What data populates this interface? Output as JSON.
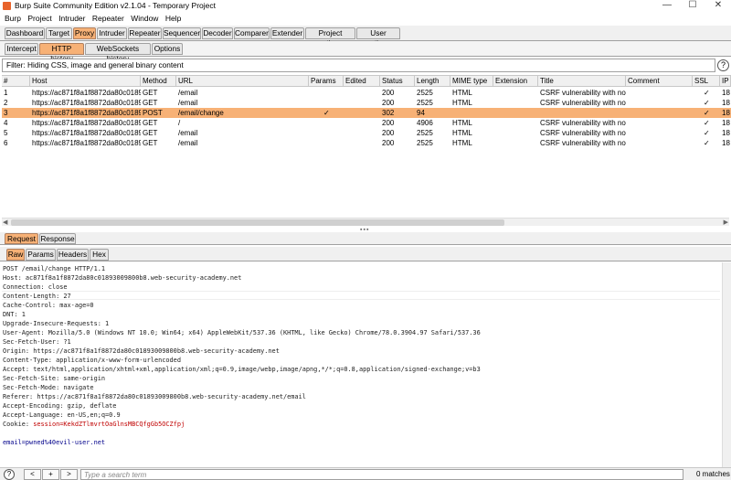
{
  "window": {
    "title": "Burp Suite Community Edition v2.1.04 - Temporary Project",
    "minimize": "—",
    "maximize": "☐",
    "close": "✕"
  },
  "menu": [
    "Burp",
    "Project",
    "Intruder",
    "Repeater",
    "Window",
    "Help"
  ],
  "top_tabs": [
    {
      "label": "Dashboard",
      "active": false
    },
    {
      "label": "Target",
      "active": false
    },
    {
      "label": "Proxy",
      "active": true
    },
    {
      "label": "Intruder",
      "active": false
    },
    {
      "label": "Repeater",
      "active": false
    },
    {
      "label": "Sequencer",
      "active": false
    },
    {
      "label": "Decoder",
      "active": false
    },
    {
      "label": "Comparer",
      "active": false
    },
    {
      "label": "Extender",
      "active": false
    },
    {
      "label": "Project options",
      "active": false
    },
    {
      "label": "User options",
      "active": false
    }
  ],
  "proxy_tabs": [
    {
      "label": "Intercept",
      "active": false
    },
    {
      "label": "HTTP history",
      "active": true
    },
    {
      "label": "WebSockets history",
      "active": false
    },
    {
      "label": "Options",
      "active": false
    }
  ],
  "filter": {
    "text": "Filter: Hiding CSS, image and general binary content",
    "help": "?"
  },
  "table": {
    "columns": [
      "#",
      "Host",
      "Method",
      "URL",
      "Params",
      "Edited",
      "Status",
      "Length",
      "MIME type",
      "Extension",
      "Title",
      "Comment",
      "SSL",
      "IP"
    ],
    "rows": [
      {
        "num": "1",
        "host": "https://ac871f8a1f8872da80c01893...",
        "method": "GET",
        "url": "/email",
        "params": "",
        "edited": "",
        "status": "200",
        "length": "2525",
        "mime": "HTML",
        "ext": "",
        "title": "CSRF vulnerability with no ...",
        "comment": "",
        "ssl": "✓",
        "ip": "18",
        "selected": false
      },
      {
        "num": "2",
        "host": "https://ac871f8a1f8872da80c01893...",
        "method": "GET",
        "url": "/email",
        "params": "",
        "edited": "",
        "status": "200",
        "length": "2525",
        "mime": "HTML",
        "ext": "",
        "title": "CSRF vulnerability with no ...",
        "comment": "",
        "ssl": "✓",
        "ip": "18",
        "selected": false
      },
      {
        "num": "3",
        "host": "https://ac871f8a1f8872da80c01893...",
        "method": "POST",
        "url": "/email/change",
        "params": "✓",
        "edited": "",
        "status": "302",
        "length": "94",
        "mime": "",
        "ext": "",
        "title": "",
        "comment": "",
        "ssl": "✓",
        "ip": "18",
        "selected": true
      },
      {
        "num": "4",
        "host": "https://ac871f8a1f8872da80c01893...",
        "method": "GET",
        "url": "/",
        "params": "",
        "edited": "",
        "status": "200",
        "length": "4906",
        "mime": "HTML",
        "ext": "",
        "title": "CSRF vulnerability with no ...",
        "comment": "",
        "ssl": "✓",
        "ip": "18",
        "selected": false
      },
      {
        "num": "5",
        "host": "https://ac871f8a1f8872da80c01893...",
        "method": "GET",
        "url": "/email",
        "params": "",
        "edited": "",
        "status": "200",
        "length": "2525",
        "mime": "HTML",
        "ext": "",
        "title": "CSRF vulnerability with no ...",
        "comment": "",
        "ssl": "✓",
        "ip": "18",
        "selected": false
      },
      {
        "num": "6",
        "host": "https://ac871f8a1f8872da80c01893...",
        "method": "GET",
        "url": "/email",
        "params": "",
        "edited": "",
        "status": "200",
        "length": "2525",
        "mime": "HTML",
        "ext": "",
        "title": "CSRF vulnerability with no ...",
        "comment": "",
        "ssl": "✓",
        "ip": "18",
        "selected": false
      }
    ]
  },
  "reqresp_tabs": [
    {
      "label": "Request",
      "active": true
    },
    {
      "label": "Response",
      "active": false
    }
  ],
  "view_tabs": [
    {
      "label": "Raw",
      "active": true
    },
    {
      "label": "Params",
      "active": false
    },
    {
      "label": "Headers",
      "active": false
    },
    {
      "label": "Hex",
      "active": false
    }
  ],
  "request_lines": [
    "POST /email/change HTTP/1.1",
    "Host: ac871f8a1f8872da80c01893009800b8.web-security-academy.net",
    "Connection: close",
    "Content-Length: 27",
    "Cache-Control: max-age=0",
    "DNT: 1",
    "Upgrade-Insecure-Requests: 1",
    "User-Agent: Mozilla/5.0 (Windows NT 10.0; Win64; x64) AppleWebKit/537.36 (KHTML, like Gecko) Chrome/78.0.3904.97 Safari/537.36",
    "Sec-Fetch-User: ?1",
    "Origin: https://ac871f8a1f8872da80c01893009800b8.web-security-academy.net",
    "Content-Type: application/x-www-form-urlencoded",
    "Accept: text/html,application/xhtml+xml,application/xml;q=0.9,image/webp,image/apng,*/*;q=0.8,application/signed-exchange;v=b3",
    "Sec-Fetch-Site: same-origin",
    "Sec-Fetch-Mode: navigate",
    "Referer: https://ac871f8a1f8872da80c01893009800b8.web-security-academy.net/email",
    "Accept-Encoding: gzip, deflate",
    "Accept-Language: en-US,en;q=0.9"
  ],
  "cookie": {
    "prefix": "Cookie: ",
    "value": "session=KekdZTlmvrtOaGlnsMBCQfgGb5OCZfpj"
  },
  "body_line": "email=pwned%40evil-user.net",
  "bottom": {
    "help": "?",
    "prev": "<",
    "add": "+",
    "next": ">",
    "search_placeholder": "Type a search term",
    "matches": "0 matches"
  }
}
